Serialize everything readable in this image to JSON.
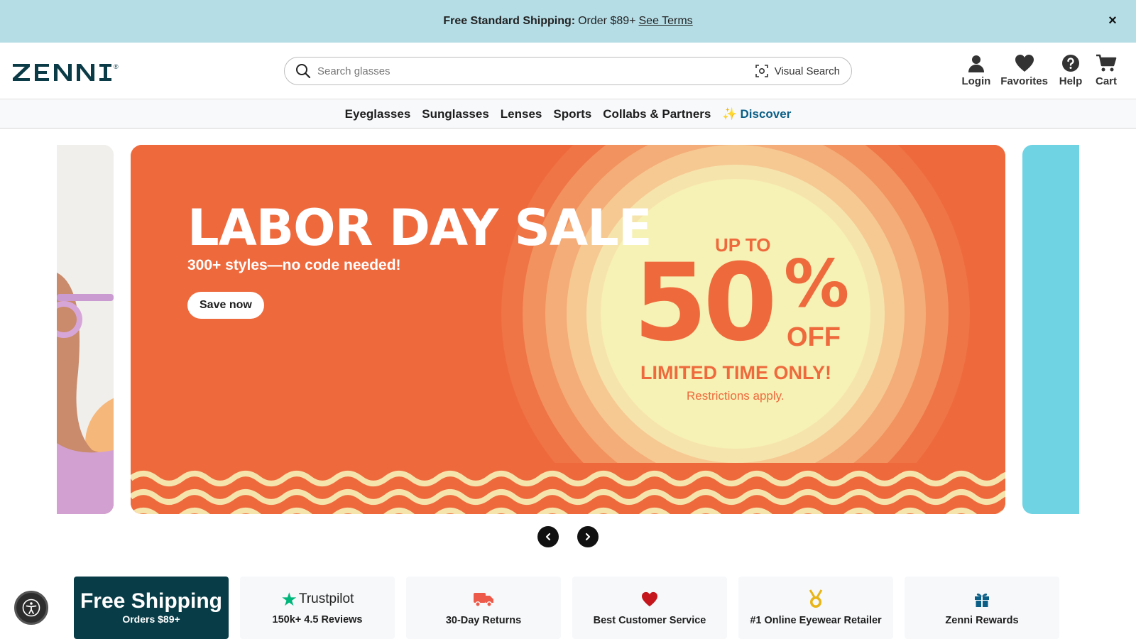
{
  "promo": {
    "bold": "Free Standard Shipping:",
    "text": "Order $89+",
    "link": "See Terms",
    "close": "×"
  },
  "brand": {
    "name": "ZENNI",
    "registered": "®"
  },
  "search": {
    "placeholder": "Search glasses",
    "visual_search_label": "Visual Search"
  },
  "header_actions": [
    {
      "label": "Login",
      "icon": "user-icon"
    },
    {
      "label": "Favorites",
      "icon": "heart-icon"
    },
    {
      "label": "Help",
      "icon": "help-icon"
    },
    {
      "label": "Cart",
      "icon": "cart-icon"
    }
  ],
  "nav": {
    "items": [
      "Eyeglasses",
      "Sunglasses",
      "Lenses",
      "Sports",
      "Collabs & Partners"
    ],
    "discover_sparkle": "✨",
    "discover": "Discover"
  },
  "hero": {
    "title": "LABOR DAY SALE",
    "subtitle": "300+ styles—no code needed!",
    "cta": "Save now",
    "up_to": "UP TO",
    "amount": "50",
    "percent": "%",
    "off": "OFF",
    "limited": "LIMITED TIME ONLY!",
    "restrictions": "Restrictions apply."
  },
  "features": {
    "shipping_title": "Free Shipping",
    "shipping_sub": "Orders $89+",
    "trustpilot_brand": "Trustpilot",
    "trustpilot_star": "★",
    "reviews": "150k+ 4.5 Reviews",
    "returns": "30-Day Returns",
    "service": "Best Customer Service",
    "retailer": "#1 Online Eyewear Retailer",
    "rewards": "Zenni Rewards"
  },
  "colors": {
    "promo_bg": "#b5dde6",
    "hero_orange": "#ee6a3d",
    "hero_cream": "#f6f1b4",
    "shipping_bg": "#083d48",
    "discover": "#0b5f86"
  }
}
